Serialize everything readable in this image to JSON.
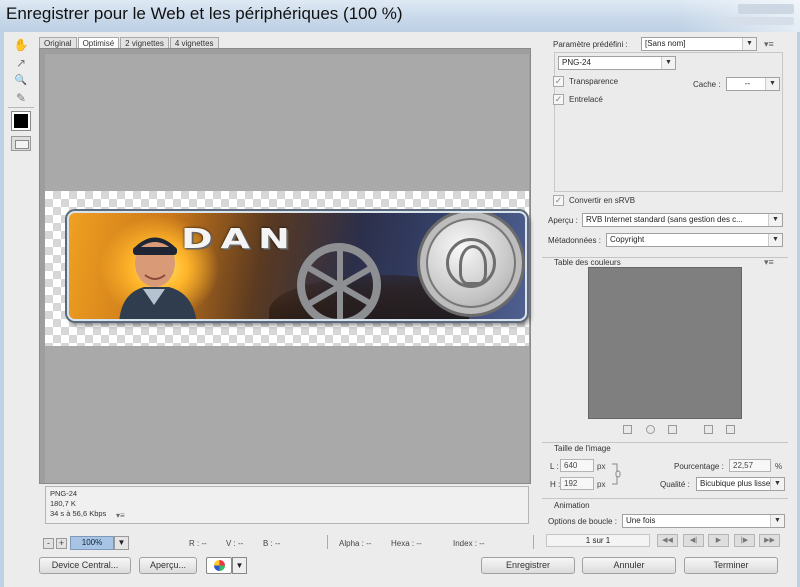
{
  "window": {
    "title": "Enregistrer pour le Web et les périphériques (100 %)"
  },
  "tools": [
    {
      "name": "hand-tool",
      "glyph": "✋"
    },
    {
      "name": "slice-select-tool",
      "glyph": "↗"
    },
    {
      "name": "zoom-tool",
      "glyph": "🔍"
    },
    {
      "name": "eyedropper-tool",
      "glyph": "✎"
    }
  ],
  "tabs": [
    "Original",
    "Optimisé",
    "2 vignettes",
    "4 vignettes"
  ],
  "active_tab": "Optimisé",
  "banner": {
    "text": "DAN"
  },
  "preview_info": {
    "format": "PNG-24",
    "size": "180,7 K",
    "time": "34 s à 56,6 Kbps",
    "menu_glyph": "▾≡"
  },
  "status": {
    "zoom": "100%",
    "minus": "-",
    "plus": "+",
    "dropdown": "▼",
    "r": "R : --",
    "v": "V : --",
    "b": "B : --",
    "alpha": "Alpha : --",
    "hexa": "Hexa : --",
    "index": "Index : --"
  },
  "buttons": {
    "device_central": "Device Central...",
    "apercu": "Aperçu...",
    "save": "Enregistrer",
    "cancel": "Annuler",
    "close": "Terminer",
    "dropdown": "▼"
  },
  "settings": {
    "preset_label": "Paramètre prédéfini :",
    "preset_value": "[Sans nom]",
    "format_value": "PNG-24",
    "transparence": "Transparence",
    "transparence_checked": true,
    "entrelace": "Entrelacé",
    "entrelace_checked": true,
    "cache_label": "Cache :",
    "cache_value": "--",
    "convert_srgb": "Convertir en sRVB",
    "convert_checked": true,
    "apercu_label": "Aperçu :",
    "apercu_value": "RVB Internet standard (sans gestion des c...",
    "meta_label": "Métadonnées :",
    "meta_value": "Copyright",
    "arrow": "▼",
    "check": "✓",
    "menu_glyph": "▾≡"
  },
  "color_table": {
    "title": "Table des couleurs"
  },
  "image_size": {
    "title": "Taille de l'image",
    "w_label": "L :",
    "w_value": "640",
    "h_label": "H :",
    "h_value": "192",
    "unit": "px",
    "percent_label": "Pourcentage :",
    "percent_value": "22,57",
    "percent_unit": "%",
    "quality_label": "Qualité :",
    "quality_value": "Bicubique plus lisse"
  },
  "animation": {
    "title": "Animation",
    "loop_label": "Options de boucle :",
    "loop_value": "Une fois",
    "frame": "1 sur 1",
    "nav": [
      "◀◀",
      "◀|",
      "▶",
      "|▶",
      "▶▶"
    ]
  }
}
